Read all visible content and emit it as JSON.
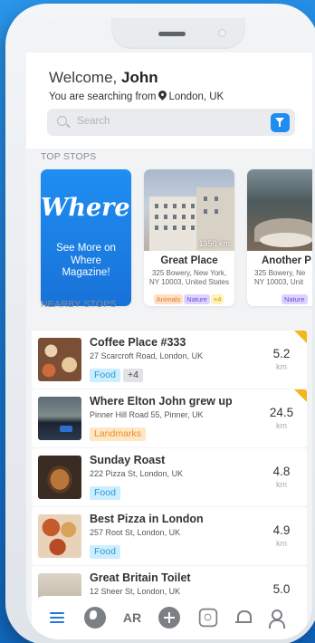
{
  "header": {
    "welcome_prefix": "Welcome,",
    "user_name": "John",
    "searching_prefix": "You are searching from",
    "location": "London, UK"
  },
  "search": {
    "placeholder": "Search"
  },
  "top_stops": {
    "title": "TOP STOPS",
    "promo": {
      "logo": "Where!",
      "text": "See More on Where Magazine!"
    },
    "cards": [
      {
        "name": "Great Place",
        "address_line1": "325 Bowery, New York,",
        "address_line2": "NY 10003, United States",
        "distance": "1350 km",
        "tags": [
          "Animals",
          "Nature",
          "+4"
        ]
      },
      {
        "name": "Another P",
        "address_line1": "325 Bowery, Ne",
        "address_line2": "NY 10003, Unit",
        "tags": [
          "Nature"
        ]
      }
    ]
  },
  "nearby": {
    "title": "NEARBY STOPS",
    "items": [
      {
        "title": "Coffee Place #333",
        "address": "27  Scarcroft Road, London, UK",
        "tags": [
          "Food",
          "+4"
        ],
        "score": "5.2",
        "unit": "km"
      },
      {
        "title": "Where Elton John grew up",
        "address": "Pinner Hill Road 55, Pinner, UK",
        "tags": [
          "Landmarks"
        ],
        "score": "24.5",
        "unit": "km"
      },
      {
        "title": "Sunday Roast",
        "address": "222 Pizza St, London, UK",
        "tags": [
          "Food"
        ],
        "score": "4.8",
        "unit": "km"
      },
      {
        "title": "Best Pizza in London",
        "address": "257 Root St, London, UK",
        "tags": [
          "Food"
        ],
        "score": "4.9",
        "unit": "km"
      },
      {
        "title": "Great Britain Toilet",
        "address": "12 Sheer St, London, UK",
        "tags": [],
        "score": "5.0",
        "unit": "km"
      }
    ]
  },
  "nav": {
    "ar_label": "AR"
  },
  "colors": {
    "accent": "#1e8cf0",
    "highlight": "#f3b71a",
    "food_tag": "#cdeefe",
    "landmark_tag": "#ffe6c4"
  }
}
